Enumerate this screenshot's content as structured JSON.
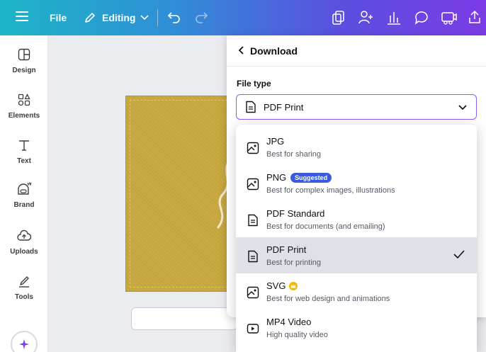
{
  "topbar": {
    "file_label": "File",
    "mode_label": "Editing"
  },
  "rail": {
    "items": [
      {
        "label": "Design",
        "icon": "layout-icon"
      },
      {
        "label": "Elements",
        "icon": "shapes-icon"
      },
      {
        "label": "Text",
        "icon": "text-icon"
      },
      {
        "label": "Brand",
        "icon": "brand-icon"
      },
      {
        "label": "Uploads",
        "icon": "upload-cloud-icon"
      },
      {
        "label": "Tools",
        "icon": "draw-icon"
      }
    ]
  },
  "download_panel": {
    "title": "Download",
    "file_type_label": "File type",
    "selected_value": "PDF Print"
  },
  "file_types": [
    {
      "name": "JPG",
      "description": "Best for sharing",
      "icon": "image-icon"
    },
    {
      "name": "PNG",
      "description": "Best for complex images, illustrations",
      "badge": "Suggested",
      "icon": "image-icon"
    },
    {
      "name": "PDF Standard",
      "description": "Best for documents (and emailing)",
      "icon": "document-icon"
    },
    {
      "name": "PDF Print",
      "description": "Best for printing",
      "icon": "document-icon",
      "selected": true
    },
    {
      "name": "SVG",
      "description": "Best for web design and animations",
      "premium": true,
      "icon": "image-icon"
    },
    {
      "name": "MP4 Video",
      "description": "High quality video",
      "icon": "video-icon"
    }
  ],
  "colors": {
    "accent": "#8b5cf6",
    "badge": "#3b5bdb",
    "premium": "#f5b800",
    "selected_row": "#dfe1e6"
  }
}
